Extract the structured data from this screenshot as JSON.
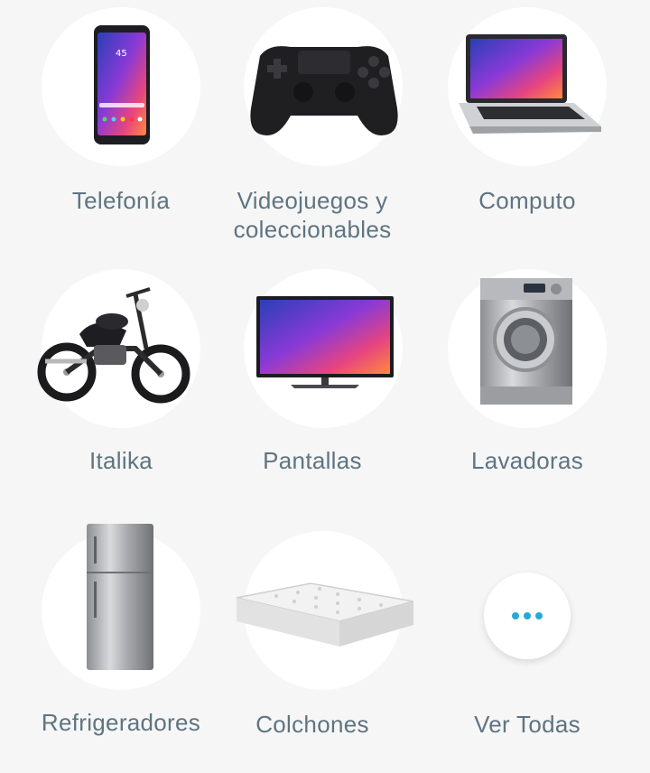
{
  "categories": [
    {
      "label": "Telefonía",
      "icon": "smartphone-icon"
    },
    {
      "label": "Videojuegos y coleccionables",
      "icon": "gamepad-icon"
    },
    {
      "label": "Computo",
      "icon": "laptop-icon"
    },
    {
      "label": "Italika",
      "icon": "motorcycle-icon"
    },
    {
      "label": "Pantallas",
      "icon": "tv-icon"
    },
    {
      "label": "Lavadoras",
      "icon": "washing-machine-icon"
    },
    {
      "label": "Refrigeradores",
      "icon": "refrigerator-icon"
    },
    {
      "label": "Colchones",
      "icon": "mattress-icon"
    }
  ],
  "view_all": {
    "label": "Ver Todas",
    "icon": "more-dots-icon"
  },
  "colors": {
    "background": "#f6f6f6",
    "label": "#5f7481",
    "accent": "#27a9d6"
  }
}
